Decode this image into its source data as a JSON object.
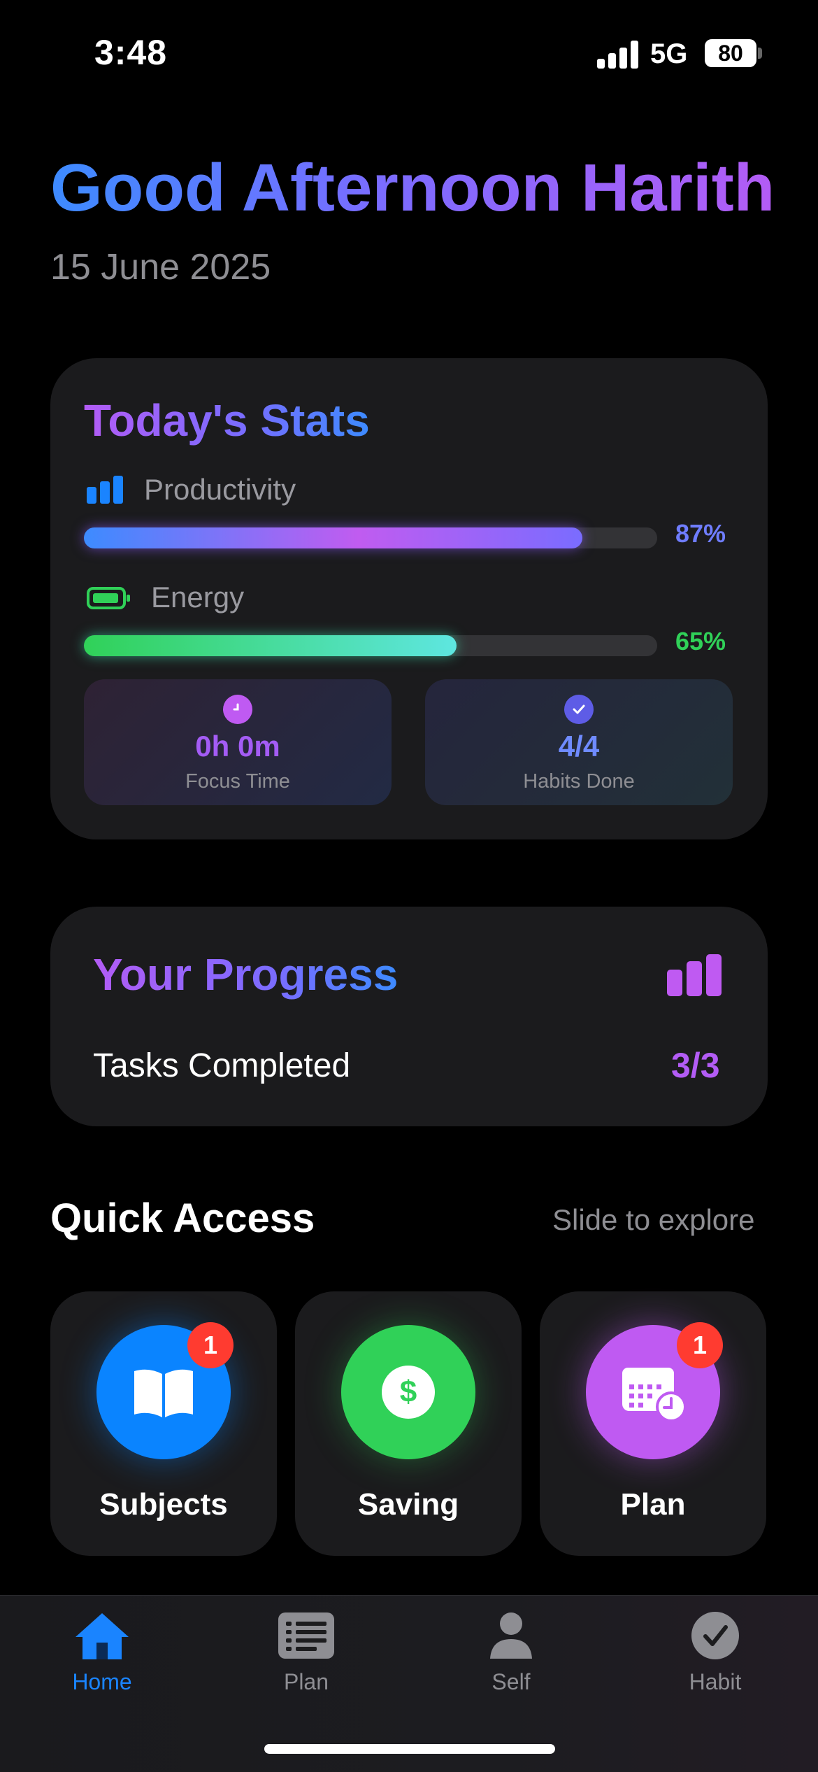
{
  "status_bar": {
    "time": "3:48",
    "network": "5G",
    "battery": "80"
  },
  "header": {
    "greeting": "Good Afternoon Harith",
    "date": "15 June 2025"
  },
  "stats": {
    "title": "Today's Stats",
    "productivity": {
      "label": "Productivity",
      "value_text": "87%",
      "value": 0.87
    },
    "energy": {
      "label": "Energy",
      "value_text": "65%",
      "value": 0.65
    },
    "focus": {
      "value": "0h 0m",
      "label": "Focus Time"
    },
    "habits": {
      "value": "4/4",
      "label": "Habits Done"
    }
  },
  "progress": {
    "title": "Your Progress",
    "tasks_label": "Tasks Completed",
    "tasks_value": "3/3"
  },
  "quick_access": {
    "title": "Quick Access",
    "hint": "Slide to explore",
    "tiles": [
      {
        "label": "Subjects",
        "badge": "1",
        "icon": "book-icon",
        "color": "#0a84ff"
      },
      {
        "label": "Saving",
        "badge": "",
        "icon": "dollar-icon",
        "color": "#30d158"
      },
      {
        "label": "Plan",
        "badge": "1",
        "icon": "calendar-clock-icon",
        "color": "#bf5af2"
      }
    ]
  },
  "tabbar": {
    "items": [
      {
        "label": "Home",
        "icon": "house-icon",
        "active": true
      },
      {
        "label": "Plan",
        "icon": "list-icon",
        "active": false
      },
      {
        "label": "Self",
        "icon": "person-icon",
        "active": false
      },
      {
        "label": "Habit",
        "icon": "checkmark-circle-icon",
        "active": false
      }
    ]
  },
  "colors": {
    "accent_blue": "#1a84ff",
    "accent_purple": "#b35cf5",
    "green": "#30d158"
  }
}
